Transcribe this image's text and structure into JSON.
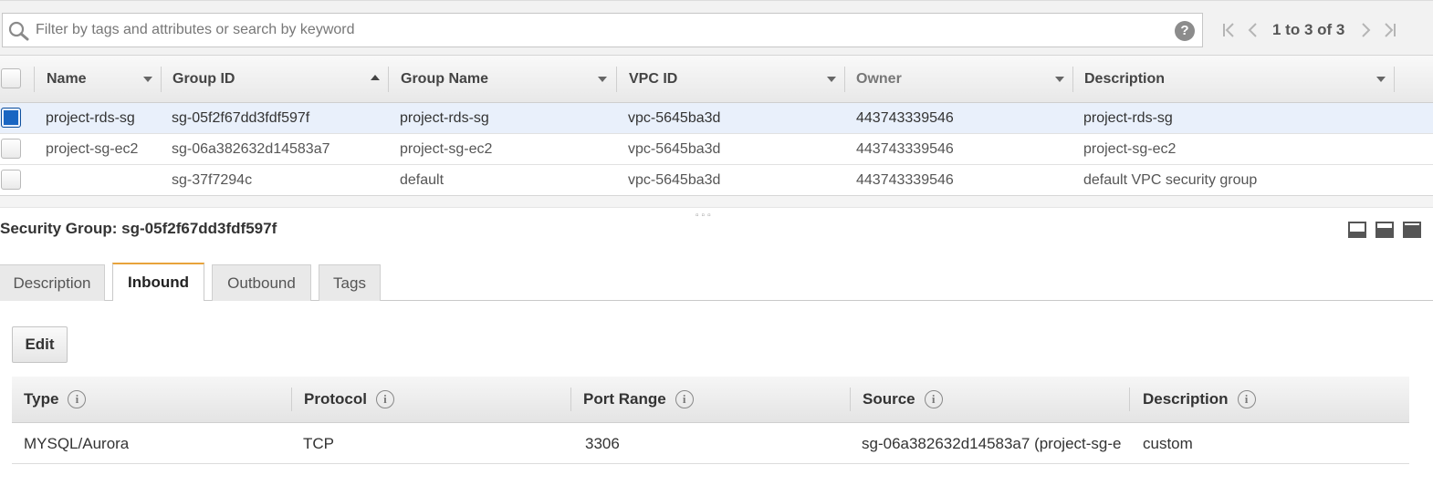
{
  "filter": {
    "placeholder": "Filter by tags and attributes or search by keyword",
    "help_icon": "?",
    "icons": [
      "search-icon",
      "help-icon"
    ]
  },
  "pagination": {
    "text": "1 to 3 of 3",
    "icons": [
      "first-page-icon",
      "previous-page-icon",
      "next-page-icon",
      "last-page-icon"
    ]
  },
  "security_groups": {
    "columns": [
      "Name",
      "Group ID",
      "Group Name",
      "VPC ID",
      "Owner",
      "Description"
    ],
    "sort_column": "Group ID",
    "sort_direction": "ascending",
    "rows": [
      {
        "selected": true,
        "name": "project-rds-sg",
        "group_id": "sg-05f2f67dd3fdf597f",
        "group_name": "project-rds-sg",
        "vpc_id": "vpc-5645ba3d",
        "owner": "443743339546",
        "description": "project-rds-sg"
      },
      {
        "selected": false,
        "name": "project-sg-ec2",
        "group_id": "sg-06a382632d14583a7",
        "group_name": "project-sg-ec2",
        "vpc_id": "vpc-5645ba3d",
        "owner": "443743339546",
        "description": "project-sg-ec2"
      },
      {
        "selected": false,
        "name": "",
        "group_id": "sg-37f7294c",
        "group_name": "default",
        "vpc_id": "vpc-5645ba3d",
        "owner": "443743339546",
        "description": "default VPC security group"
      }
    ]
  },
  "detail": {
    "title": "Security Group: sg-05f2f67dd3fdf597f",
    "tabs": [
      "Description",
      "Inbound",
      "Outbound",
      "Tags"
    ],
    "active_tab": "Inbound",
    "edit_label": "Edit",
    "view_icons": [
      "pane-small-icon",
      "pane-medium-icon",
      "pane-large-icon"
    ],
    "rules": {
      "columns": [
        "Type",
        "Protocol",
        "Port Range",
        "Source",
        "Description"
      ],
      "info_icon": "i",
      "rows": [
        {
          "type": "MYSQL/Aurora",
          "protocol": "TCP",
          "port_range": "3306",
          "source": "sg-06a382632d14583a7 (project-sg-e",
          "description": "custom"
        }
      ]
    }
  },
  "colors": {
    "selected_row": "#e9f0fb",
    "checkbox_checked": "#1a66c2",
    "active_tab_accent": "#e8a33b"
  }
}
